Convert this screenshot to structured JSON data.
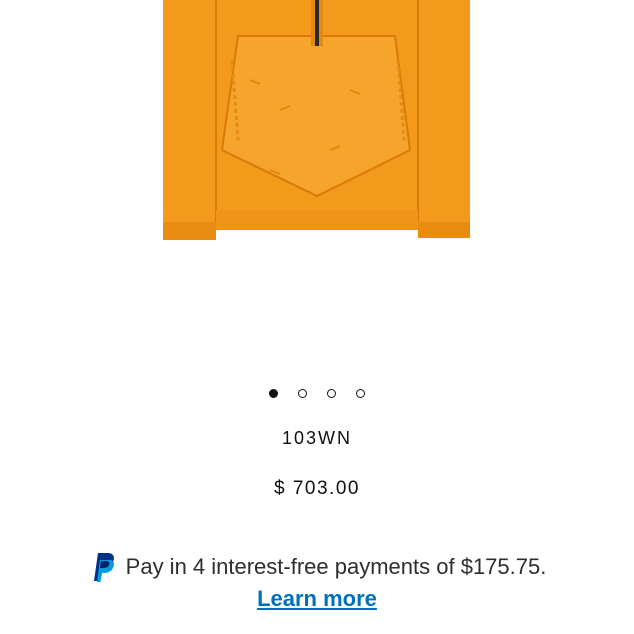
{
  "product": {
    "name": "103WN",
    "price": "$ 703.00",
    "image_icon": "orange-anorak-jacket"
  },
  "carousel": {
    "total": 4,
    "active": 1
  },
  "paypal": {
    "icon": "paypal-icon",
    "message": "Pay in 4 interest-free payments of $175.75.",
    "link_label": "Learn more"
  },
  "colors": {
    "garment": "#f39a1c",
    "link": "#0070ba",
    "paypal_dark": "#003087",
    "paypal_light": "#009cde"
  }
}
